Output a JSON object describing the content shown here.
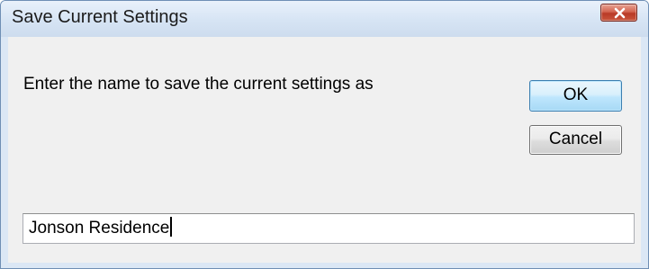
{
  "window": {
    "title": "Save Current Settings",
    "close_icon": "close-icon"
  },
  "dialog": {
    "prompt": "Enter the name to save the current settings as",
    "ok_label": "OK",
    "cancel_label": "Cancel",
    "name_value": "Jonson Residence"
  },
  "colors": {
    "title_bar": "#dbe7f5",
    "close_button": "#c9553c",
    "client_background": "#f0f0f0",
    "default_button_border": "#3c7fb1"
  }
}
